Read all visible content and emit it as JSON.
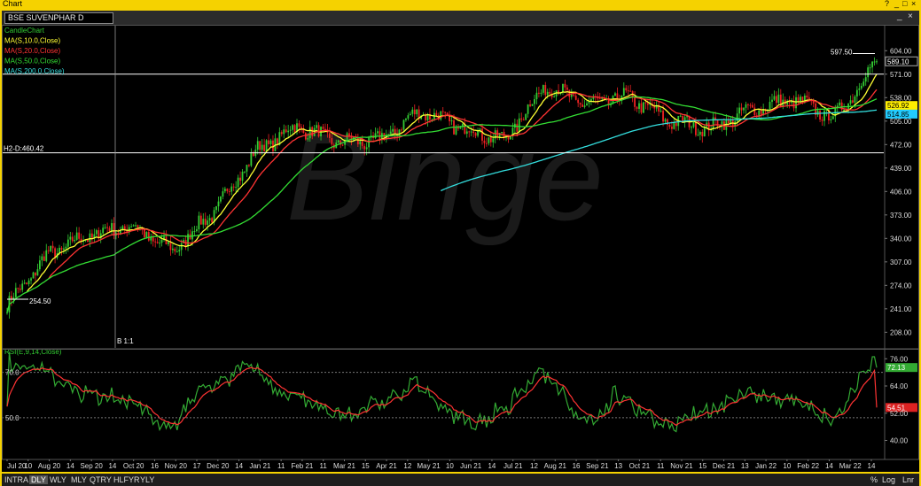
{
  "window": {
    "title": "Chart",
    "controls": [
      "?",
      "_",
      "□",
      "×"
    ]
  },
  "symbol_bar": {
    "symbol": "BSE SUVENPHAR D",
    "controls": [
      "_",
      "×"
    ]
  },
  "chart_data": [
    {
      "type": "candlestick",
      "title": "BSE SUVENPHAR D",
      "watermark": "Binge",
      "x_ticks": [
        "Jul 20",
        "10",
        "Aug 20",
        "14",
        "Sep 20",
        "14",
        "Oct 20",
        "16",
        "Nov 20",
        "17",
        "Dec 20",
        "14",
        "Jan 21",
        "11",
        "Feb 21",
        "11",
        "Mar 21",
        "15",
        "Apr 21",
        "12",
        "May 21",
        "10",
        "Jun 21",
        "14",
        "Jul 21",
        "12",
        "Aug 21",
        "16",
        "Sep 21",
        "13",
        "Oct 21",
        "11",
        "Nov 21",
        "15",
        "Dec 21",
        "13",
        "Jan 22",
        "10",
        "Feb 22",
        "14",
        "Mar 22",
        "14"
      ],
      "y_ticks": [
        604.0,
        571.0,
        538.0,
        505.0,
        472.0,
        439.0,
        406.0,
        373.0,
        340.0,
        307.0,
        274.0,
        241.0,
        208.0
      ],
      "ylim": [
        186,
        633
      ],
      "legend": [
        {
          "label": "CandleChart",
          "color": "#33cc33"
        },
        {
          "label": "MA(S,10.0,Close)",
          "color": "#ffff33"
        },
        {
          "label": "MA(S,20.0,Close)",
          "color": "#ff3333"
        },
        {
          "label": "MA(S,50.0,Close)",
          "color": "#33dd33"
        },
        {
          "label": "MA(S,200.0,Close)",
          "color": "#33dddd"
        }
      ],
      "price_labels": [
        {
          "value": "589.10",
          "color": "#ffffff"
        },
        {
          "value": "526.92",
          "color": "#ffee00"
        },
        {
          "value": "514.85",
          "color": "#33ccff"
        }
      ],
      "annotations": {
        "high": "597.50",
        "low": "254.50",
        "hline_label": "H2-D:460.42",
        "vline_label": "B 1:1"
      },
      "horizontal_lines": [
        571,
        460.42
      ],
      "last_close": 589.1,
      "ma_last": {
        "ma10": 526.92,
        "ma200": 514.85
      },
      "close_keypoints": [
        [
          "Jul 20",
          245
        ],
        [
          "Aug 20",
          318
        ],
        [
          "Sep 20",
          345
        ],
        [
          "Oct 20",
          358
        ],
        [
          "Nov 20",
          322
        ],
        [
          "Dec 20",
          378
        ],
        [
          "Jan 21",
          462
        ],
        [
          "Feb 21",
          498
        ],
        [
          "Mar 21",
          475
        ],
        [
          "Apr 21",
          478
        ],
        [
          "May 21",
          520
        ],
        [
          "Jun 21",
          495
        ],
        [
          "Jul 21",
          478
        ],
        [
          "Aug 21",
          555
        ],
        [
          "Sep 21",
          528
        ],
        [
          "Oct 21",
          540
        ],
        [
          "Nov 21",
          505
        ],
        [
          "Dec 21",
          495
        ],
        [
          "Jan 22",
          522
        ],
        [
          "Feb 22",
          535
        ],
        [
          "Mar 22",
          510
        ],
        [
          "Mar 22 end",
          589
        ]
      ]
    },
    {
      "type": "line",
      "title": "RSI(E,9,14,Close)",
      "y_ticks": [
        76.0,
        64.0,
        52.0,
        40.0
      ],
      "ylim": [
        32,
        80
      ],
      "levels": [
        70.0,
        50.0
      ],
      "price_labels": [
        {
          "value": "72.13",
          "color": "#33cc33"
        },
        {
          "value": "54.51",
          "color": "#ff3333"
        }
      ],
      "series": [
        {
          "name": "RSI",
          "color": "#33aa33",
          "last": 72.13
        },
        {
          "name": "Signal",
          "color": "#ff3333",
          "last": 54.51
        }
      ]
    }
  ],
  "bottom_bar": {
    "timeframes": [
      "INTRA",
      "DLY",
      "WLY",
      "MLY",
      "QTRY",
      "HLFYR",
      "YLY"
    ],
    "selected": "DLY",
    "right": [
      "%",
      "Log",
      "Lnr"
    ]
  }
}
